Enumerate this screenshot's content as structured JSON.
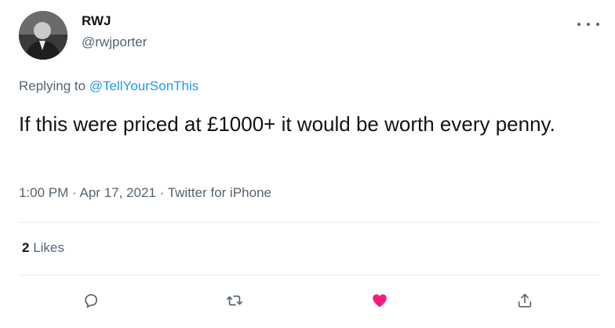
{
  "author": {
    "name": "RWJ",
    "handle": "@rwjporter"
  },
  "reply": {
    "prefix": "Replying to ",
    "to": "@TellYourSonThis"
  },
  "tweet": {
    "text": "If this were priced at £1000+ it would be worth every penny.",
    "time": "1:00 PM",
    "date": "Apr 17, 2021",
    "source": "Twitter for iPhone",
    "separator": "·"
  },
  "stats": {
    "likes_count": "2",
    "likes_label": "Likes"
  },
  "actions": {
    "icons": [
      "reply-icon",
      "retweet-icon",
      "like-icon",
      "share-icon"
    ],
    "like_active": true
  },
  "colors": {
    "text": "#0f1419",
    "secondary": "#536471",
    "link": "#1d9bf0",
    "like": "#f91880",
    "divider": "#e6ecf0"
  }
}
